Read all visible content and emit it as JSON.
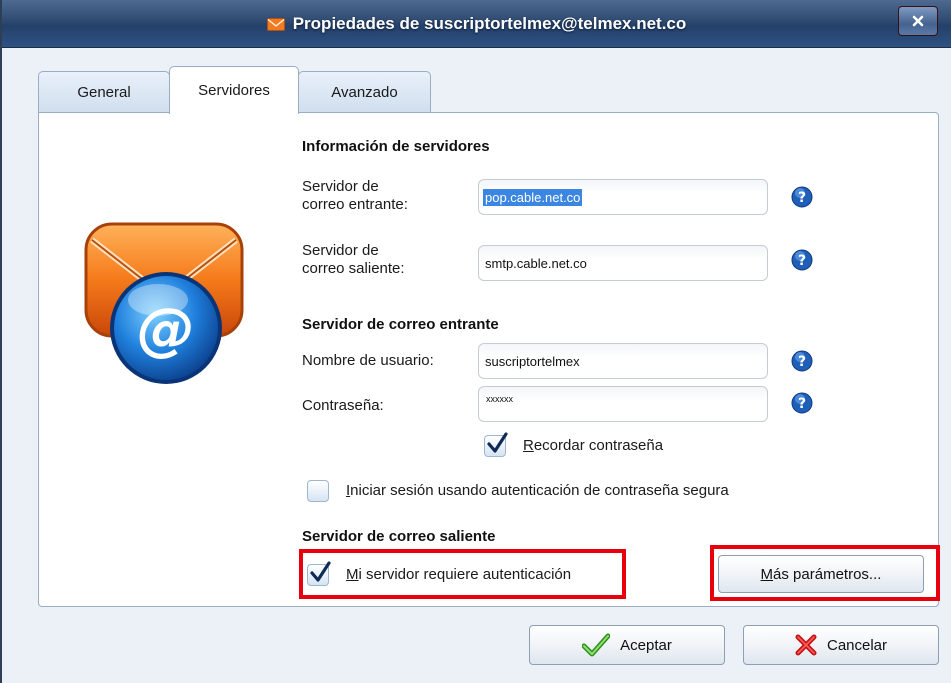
{
  "window": {
    "title": "Propiedades de suscriptortelmex@telmex.net.co",
    "title_icon": "envelope-icon",
    "close_icon": "close-icon"
  },
  "tabs": [
    {
      "label": "General",
      "active": false
    },
    {
      "label": "Servidores",
      "active": true
    },
    {
      "label": "Avanzado",
      "active": false
    }
  ],
  "logo": {
    "icon": "email-at-icon"
  },
  "server_info": {
    "heading": "Información de servidores",
    "incoming_label_1": "Servidor de",
    "incoming_label_2": "correo entrante:",
    "incoming_value": "pop.cable.net.co",
    "outgoing_label_1": "Servidor de",
    "outgoing_label_2": "correo saliente:",
    "outgoing_value": "smtp.cable.net.co"
  },
  "incoming": {
    "heading": "Servidor de correo entrante",
    "username_label": "Nombre de usuario:",
    "username_value": "suscriptortelmex",
    "password_label": "Contraseña:",
    "password_value": "xxxxxx",
    "remember_first": "R",
    "remember_rest": "ecordar contraseña",
    "remember_checked": true,
    "spa_first": "I",
    "spa_rest": "niciar sesión usando autenticación de contraseña segura",
    "spa_checked": false
  },
  "outgoing": {
    "heading": "Servidor de correo saliente",
    "auth_first": "M",
    "auth_rest": "i servidor requiere autenticación",
    "auth_checked": true,
    "more_first": "M",
    "more_rest": "ás parámetros..."
  },
  "buttons": {
    "ok_label": "Aceptar",
    "ok_icon": "checkmark-icon",
    "cancel_label": "Cancelar",
    "cancel_icon": "x-icon"
  },
  "colors": {
    "highlight": "#e8000d",
    "titlebar": "#2f4a70",
    "selection": "#3a86e0"
  }
}
